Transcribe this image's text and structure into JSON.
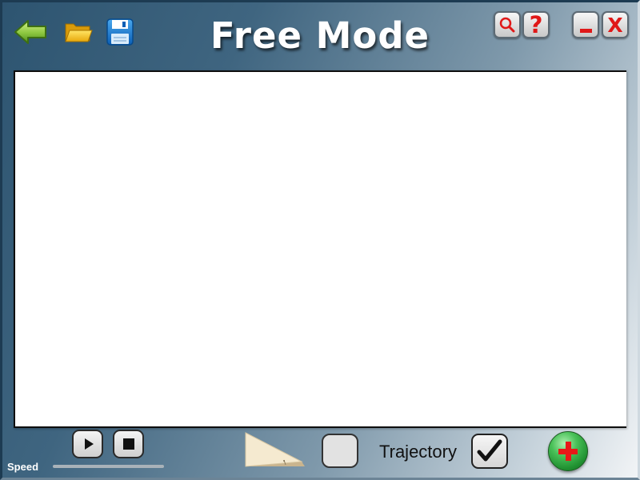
{
  "window": {
    "title": "Free Mode"
  },
  "toolbar": {
    "back_icon": "back-arrow-icon",
    "open_icon": "folder-open-icon",
    "save_icon": "floppy-disk-icon"
  },
  "window_controls": {
    "search_icon": "magnifier-icon",
    "help_label": "?",
    "minimize_icon": "minimize-icon",
    "close_label": "X"
  },
  "playback": {
    "play_icon": "play-icon",
    "stop_icon": "stop-icon",
    "speed_label": "Speed"
  },
  "tools": {
    "ramp_icon": "inclined-plane-icon",
    "trajectory_label": "Trajectory",
    "trajectory_checked": true,
    "add_icon": "plus-icon"
  },
  "colors": {
    "accent_red": "#e01818",
    "add_green": "#2fa842"
  }
}
